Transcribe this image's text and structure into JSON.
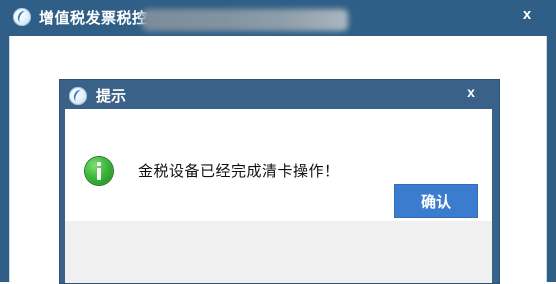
{
  "main_window": {
    "title": "增值税发票税控",
    "close_label": "x"
  },
  "dialog": {
    "title": "提示",
    "close_label": "x",
    "message": "金税设备已经完成清卡操作！",
    "ok_label": "确认"
  },
  "colors": {
    "titlebar": "#2f5f86",
    "dialog_frame": "#3a6288",
    "button": "#3b7ccf",
    "info_icon": "#3eb63a"
  },
  "icons": {
    "app": "app-logo-icon",
    "info": "info-icon"
  }
}
